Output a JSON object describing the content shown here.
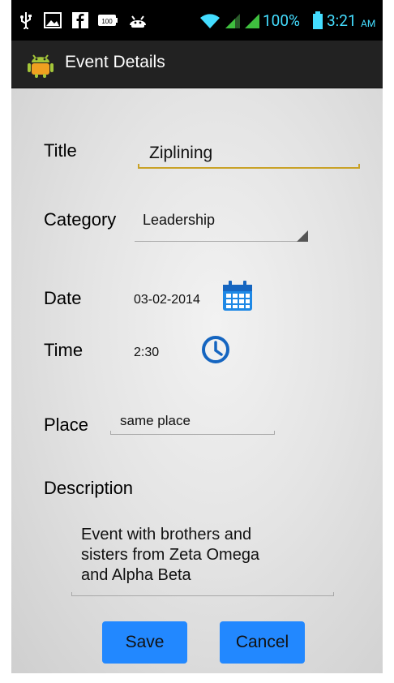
{
  "status_bar": {
    "battery_percent": "100%",
    "time": "3:21",
    "am_pm": "AM",
    "badge": "100"
  },
  "action_bar": {
    "title": "Event Details"
  },
  "form": {
    "title_label": "Title",
    "title_value": "Ziplining",
    "category_label": "Category",
    "category_value": "Leadership",
    "date_label": "Date",
    "date_value": "03-02-2014",
    "time_label": "Time",
    "time_value": "2:30",
    "place_label": "Place",
    "place_value": "same place",
    "description_label": "Description",
    "description_lines": [
      "Event with brothers and",
      "sisters from Zeta Omega",
      "and Alpha Beta"
    ]
  },
  "buttons": {
    "save": "Save",
    "cancel": "Cancel"
  },
  "colors": {
    "accent_underline": "#c9a227",
    "button": "#2288ff",
    "status_bar_icons": "#44ddff",
    "icon_blue": "#1e88c8"
  }
}
